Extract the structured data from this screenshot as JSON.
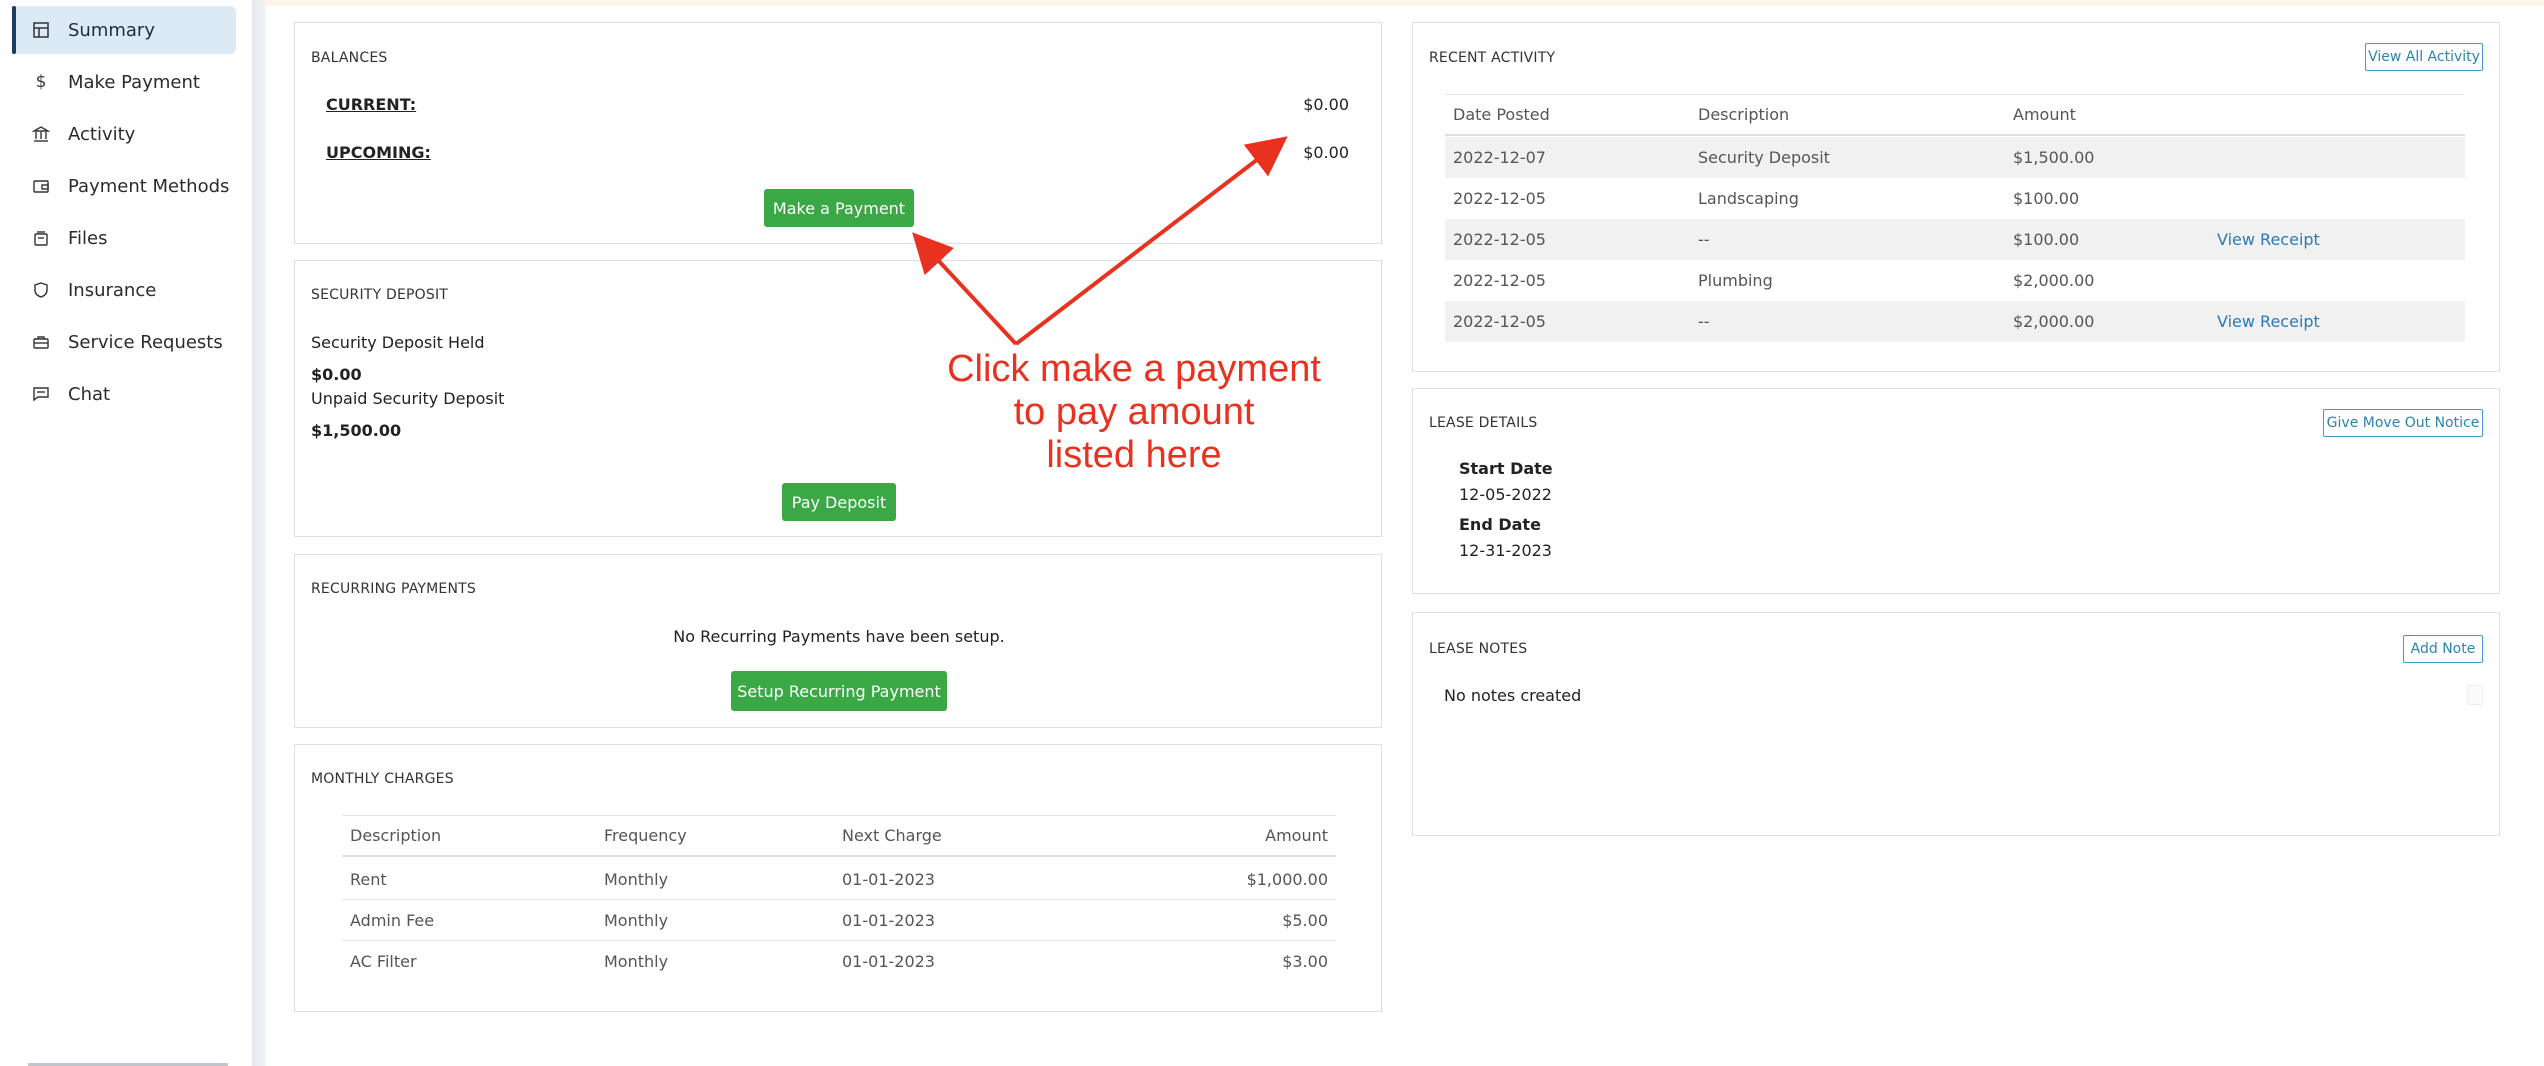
{
  "sidebar": {
    "items": [
      {
        "label": "Summary",
        "icon": "layout-icon",
        "active": true
      },
      {
        "label": "Make Payment",
        "icon": "dollar-icon"
      },
      {
        "label": "Activity",
        "icon": "bank-icon"
      },
      {
        "label": "Payment Methods",
        "icon": "wallet-icon"
      },
      {
        "label": "Files",
        "icon": "files-icon"
      },
      {
        "label": "Insurance",
        "icon": "shield-icon"
      },
      {
        "label": "Service Requests",
        "icon": "toolbox-icon"
      },
      {
        "label": "Chat",
        "icon": "chat-icon"
      }
    ]
  },
  "balances": {
    "title": "BALANCES",
    "current_label": "CURRENT:",
    "current_value": "$0.00",
    "upcoming_label": "UPCOMING:",
    "upcoming_value": "$0.00",
    "button": "Make a Payment"
  },
  "security_deposit": {
    "title": "SECURITY DEPOSIT",
    "held_label": "Security Deposit Held",
    "held_value": "$0.00",
    "unpaid_label": "Unpaid Security Deposit",
    "unpaid_value": "$1,500.00",
    "button": "Pay Deposit"
  },
  "recurring": {
    "title": "RECURRING PAYMENTS",
    "message": "No Recurring Payments have been setup.",
    "button": "Setup Recurring Payment"
  },
  "monthly_charges": {
    "title": "MONTHLY CHARGES",
    "headers": [
      "Description",
      "Frequency",
      "Next Charge",
      "Amount"
    ],
    "rows": [
      [
        "Rent",
        "Monthly",
        "01-01-2023",
        "$1,000.00"
      ],
      [
        "Admin Fee",
        "Monthly",
        "01-01-2023",
        "$5.00"
      ],
      [
        "AC Filter",
        "Monthly",
        "01-01-2023",
        "$3.00"
      ]
    ]
  },
  "recent_activity": {
    "title": "RECENT ACTIVITY",
    "button": "View All Activity",
    "headers": [
      "Date Posted",
      "Description",
      "Amount"
    ],
    "rows": [
      [
        "2022-12-07",
        "Security Deposit",
        "$1,500.00",
        ""
      ],
      [
        "2022-12-05",
        "Landscaping",
        "$100.00",
        ""
      ],
      [
        "2022-12-05",
        "--",
        "$100.00",
        "View Receipt"
      ],
      [
        "2022-12-05",
        "Plumbing",
        "$2,000.00",
        ""
      ],
      [
        "2022-12-05",
        "--",
        "$2,000.00",
        "View Receipt"
      ]
    ]
  },
  "lease_details": {
    "title": "LEASE DETAILS",
    "button": "Give Move Out Notice",
    "start_label": "Start Date",
    "start_value": "12-05-2022",
    "end_label": "End Date",
    "end_value": "12-31-2023"
  },
  "lease_notes": {
    "title": "LEASE NOTES",
    "button": "Add Note",
    "message": "No notes created"
  },
  "annotation": {
    "line1": "Click make a payment",
    "line2": "to pay amount",
    "line3": "listed here",
    "color": "#e8321f"
  }
}
